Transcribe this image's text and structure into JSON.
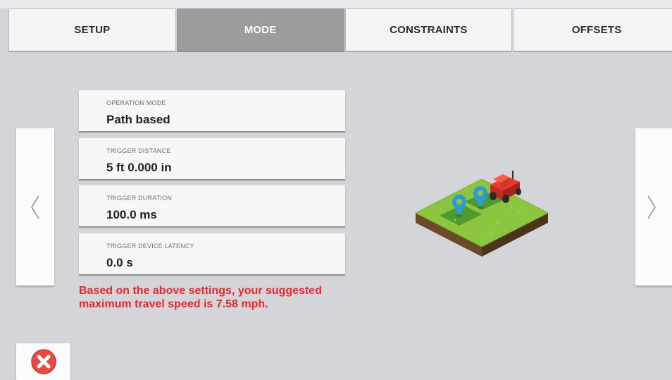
{
  "tabs": [
    {
      "label": "SETUP",
      "active": false
    },
    {
      "label": "MODE",
      "active": true
    },
    {
      "label": "CONSTRAINTS",
      "active": false
    },
    {
      "label": "OFFSETS",
      "active": false
    }
  ],
  "fields": [
    {
      "label": "OPERATION MODE",
      "value": "Path based"
    },
    {
      "label": "TRIGGER DISTANCE",
      "value": "5 ft 0.000 in"
    },
    {
      "label": "TRIGGER DURATION",
      "value": "100.0 ms"
    },
    {
      "label": "TRIGGER DEVICE LATENCY",
      "value": "0.0 s"
    }
  ],
  "warning": "Based on the above settings, your suggested maximum travel speed is 7.58 mph.",
  "icons": {
    "prev": "chevron-left-icon",
    "next": "chevron-right-icon",
    "close": "close-icon",
    "illustration": "tractor-field-illustration"
  },
  "colors": {
    "active_tab": "#9c9c9e",
    "warning": "#e8262b",
    "close": "#e84a45"
  }
}
